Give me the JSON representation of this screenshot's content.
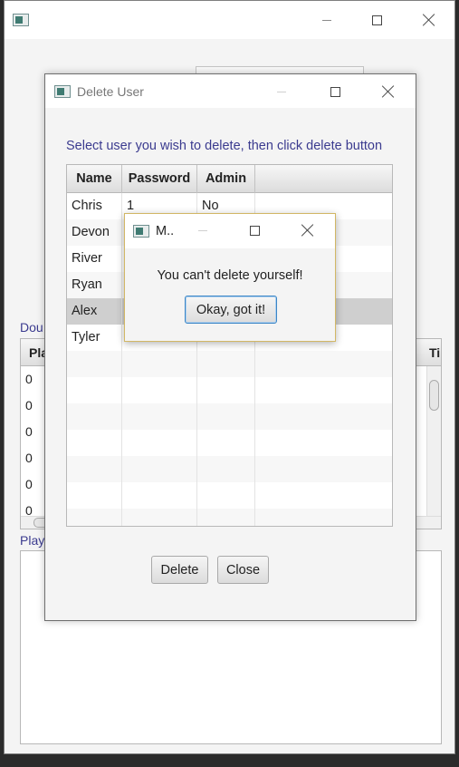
{
  "main_window": {
    "label_top": "Dou",
    "label_bottom": "Play",
    "table": {
      "col1": "Pla",
      "col2": "Ti",
      "rows": [
        "0",
        "0",
        "0",
        "0",
        "0",
        "0"
      ]
    }
  },
  "delete_dialog": {
    "title": "Delete User",
    "instruction": "Select user you wish to delete, then click delete button",
    "columns": [
      "Name",
      "Password",
      "Admin"
    ],
    "rows": [
      {
        "name": "Chris",
        "password": "1",
        "admin": "No"
      },
      {
        "name": "Devon",
        "password": "",
        "admin": ""
      },
      {
        "name": "River",
        "password": "",
        "admin": ""
      },
      {
        "name": "Ryan",
        "password": "",
        "admin": ""
      },
      {
        "name": "Alex",
        "password": "",
        "admin": ""
      },
      {
        "name": "Tyler",
        "password": "",
        "admin": ""
      }
    ],
    "selected_row": "Alex",
    "delete_label": "Delete",
    "close_label": "Close"
  },
  "message_dialog": {
    "title": "M..",
    "text": "You can't delete yourself!",
    "ok_label": "Okay, got it!"
  },
  "colors": {
    "accent_text": "#3b3b8f",
    "selected_row": "#cfcfcf",
    "focus_border": "#3c86c6"
  }
}
